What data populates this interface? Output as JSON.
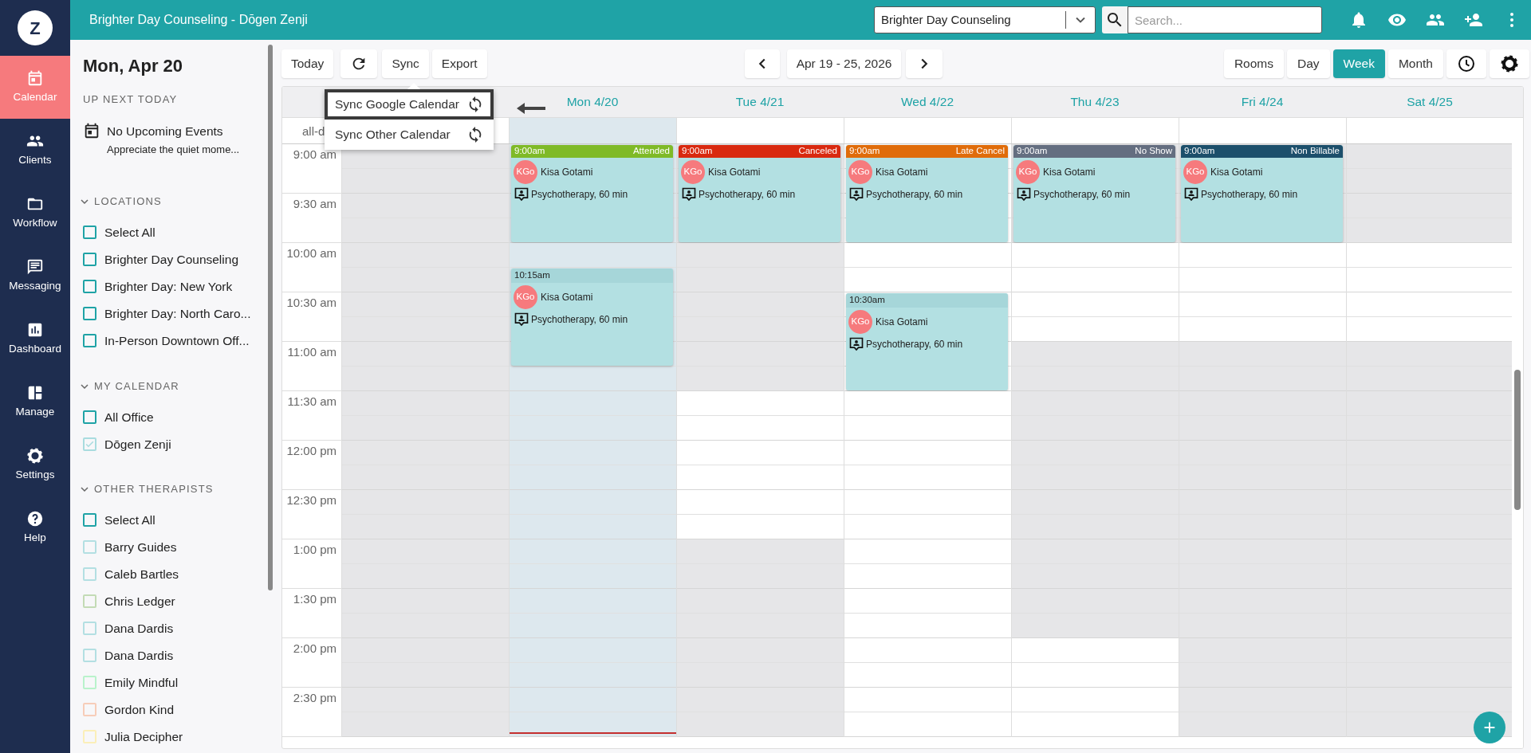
{
  "nav": {
    "logo": "Z",
    "items": [
      {
        "label": "Calendar",
        "selected": true
      },
      {
        "label": "Clients",
        "selected": false
      },
      {
        "label": "Workflow",
        "selected": false
      },
      {
        "label": "Messaging",
        "selected": false
      },
      {
        "label": "Dashboard",
        "selected": false
      },
      {
        "label": "Manage",
        "selected": false
      },
      {
        "label": "Settings",
        "selected": false
      },
      {
        "label": "Help",
        "selected": false
      }
    ]
  },
  "header": {
    "title": "Brighter Day Counseling - Dōgen Zenji",
    "location_select": {
      "value": "Brighter Day Counseling"
    },
    "search": {
      "placeholder": "Search..."
    }
  },
  "side_panel": {
    "date": "Mon, Apr 20",
    "up_next": {
      "heading": "UP NEXT TODAY",
      "title": "No Upcoming Events",
      "subtitle": "Appreciate the quiet mome..."
    },
    "sections": [
      {
        "title": "LOCATIONS",
        "expanded": true,
        "items": [
          {
            "label": "Select All",
            "checked": false,
            "color": "#1fa3a6"
          },
          {
            "label": "Brighter Day Counseling",
            "checked": false,
            "color": "#1fa3a6"
          },
          {
            "label": "Brighter Day: New York",
            "checked": false,
            "color": "#1fa3a6"
          },
          {
            "label": "Brighter Day: North Caro...",
            "checked": false,
            "color": "#1fa3a6"
          },
          {
            "label": "In-Person Downtown Off...",
            "checked": false,
            "color": "#1fa3a6"
          }
        ]
      },
      {
        "title": "MY CALENDAR",
        "expanded": true,
        "items": [
          {
            "label": "All Office",
            "checked": false,
            "color": "#1fa3a6"
          },
          {
            "label": "Dōgen Zenji",
            "checked": true,
            "color": "#a9dcdf"
          }
        ]
      },
      {
        "title": "OTHER THERAPISTS",
        "expanded": true,
        "items": [
          {
            "label": "Select All",
            "checked": false,
            "color": "#1fa3a6"
          },
          {
            "label": "Barry Guides",
            "checked": false,
            "color": "#b3dfe2"
          },
          {
            "label": "Caleb Bartles",
            "checked": false,
            "color": "#b3dfe2"
          },
          {
            "label": "Chris Ledger",
            "checked": false,
            "color": "#c3dbb5"
          },
          {
            "label": "Dana Dardis",
            "checked": false,
            "color": "#b3dfe2"
          },
          {
            "label": "Dana Dardis",
            "checked": false,
            "color": "#b3dfe2"
          },
          {
            "label": "Emily Mindful",
            "checked": false,
            "color": "#b9f2cb"
          },
          {
            "label": "Gordon Kind",
            "checked": false,
            "color": "#f7cdb9"
          },
          {
            "label": "Julia Decipher",
            "checked": false,
            "color": "#fbefb9"
          }
        ]
      }
    ]
  },
  "toolbar": {
    "today": "Today",
    "sync": "Sync",
    "export": "Export",
    "date_range": "Apr 19 - 25, 2026",
    "views": [
      {
        "label": "Rooms",
        "selected": false
      },
      {
        "label": "Day",
        "selected": false
      },
      {
        "label": "Week",
        "selected": true
      },
      {
        "label": "Month",
        "selected": false
      }
    ]
  },
  "sync_menu": {
    "open": true,
    "items": [
      {
        "label": "Sync Google Calendar",
        "highlighted": true
      },
      {
        "label": "Sync Other Calendar",
        "highlighted": false
      }
    ]
  },
  "calendar": {
    "all_day_label": "all-d",
    "times": [
      "9:00 am",
      "9:30 am",
      "10:00 am",
      "10:30 am",
      "11:00 am",
      "11:30 am",
      "12:00 pm",
      "12:30 pm",
      "1:00 pm",
      "1:30 pm",
      "2:00 pm",
      "2:30 pm"
    ],
    "days": [
      {
        "today": false,
        "open": [
          false,
          false,
          false,
          false,
          false,
          false,
          false,
          false,
          false,
          false,
          false,
          false
        ]
      },
      {
        "label": "Mon 4/20",
        "today": true,
        "current_time_marker": true,
        "events": [
          {
            "time": "9:00am",
            "status": "Attended",
            "color": "#7fba27",
            "initials": "KGo",
            "client": "Kisa Gotami",
            "service": "Psychotherapy, 60 min"
          },
          {
            "time": "10:15am",
            "initials": "KGo",
            "client": "Kisa Gotami",
            "service": "Psychotherapy, 60 min"
          }
        ]
      },
      {
        "label": "Tue 4/21",
        "today": false,
        "open": [
          false,
          false,
          false,
          false,
          false,
          true,
          true,
          true,
          false,
          false,
          false,
          false
        ],
        "events": [
          {
            "time": "9:00am",
            "status": "Canceled",
            "color": "#d9290f",
            "initials": "KGo",
            "client": "Kisa Gotami",
            "service": "Psychotherapy, 60 min"
          }
        ]
      },
      {
        "label": "Wed 4/22",
        "today": false,
        "open": [
          true,
          true,
          true,
          true,
          true,
          true,
          true,
          true,
          true,
          true,
          true,
          true
        ],
        "events": [
          {
            "time": "9:00am",
            "status": "Late Cancel",
            "color": "#e06c0a",
            "initials": "KGo",
            "client": "Kisa Gotami",
            "service": "Psychotherapy, 60 min"
          },
          {
            "time": "10:30am",
            "initials": "KGo",
            "client": "Kisa Gotami",
            "service": "Psychotherapy, 60 min"
          }
        ]
      },
      {
        "label": "Thu 4/23",
        "today": false,
        "open": [
          false,
          false,
          true,
          true,
          false,
          false,
          false,
          false,
          false,
          false,
          true,
          true
        ],
        "events": [
          {
            "time": "9:00am",
            "status": "No Show",
            "color": "#646e80",
            "initials": "KGo",
            "client": "Kisa Gotami",
            "service": "Psychotherapy, 60 min"
          }
        ]
      },
      {
        "label": "Fri 4/24",
        "today": false,
        "open": [
          false,
          false,
          true,
          true,
          false,
          false,
          false,
          false,
          false,
          false,
          false,
          false
        ],
        "events": [
          {
            "time": "9:00am",
            "status": "Non Billable",
            "color": "#1c4f6b",
            "initials": "KGo",
            "client": "Kisa Gotami",
            "service": "Psychotherapy, 60 min"
          }
        ]
      },
      {
        "label": "Sat 4/25",
        "today": false,
        "open": [
          false,
          false,
          true,
          true,
          false,
          false,
          false,
          false,
          false,
          false,
          false,
          false
        ]
      }
    ]
  }
}
